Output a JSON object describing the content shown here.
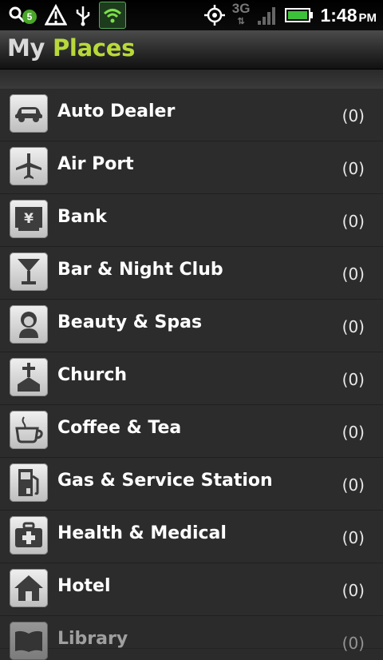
{
  "status_bar": {
    "notification_count": "5",
    "network": "3G",
    "time": "1:48",
    "ampm": "PM",
    "icons": [
      "search-notification-icon",
      "warning-icon",
      "usb-icon",
      "wifi-app-icon",
      "gps-icon",
      "signal-icon",
      "battery-icon"
    ]
  },
  "header": {
    "title_part1": "My",
    "title_part2": "Places",
    "accent_color": "#b8d93a"
  },
  "places": [
    {
      "label": "Auto Dealer",
      "count": "(0)",
      "icon": "car-icon"
    },
    {
      "label": "Air Port",
      "count": "(0)",
      "icon": "airplane-icon"
    },
    {
      "label": "Bank",
      "count": "(0)",
      "icon": "yen-icon"
    },
    {
      "label": "Bar & Night Club",
      "count": "(0)",
      "icon": "cocktail-icon"
    },
    {
      "label": "Beauty & Spas",
      "count": "(0)",
      "icon": "woman-icon"
    },
    {
      "label": "Church",
      "count": "(0)",
      "icon": "church-icon"
    },
    {
      "label": "Coffee & Tea",
      "count": "(0)",
      "icon": "coffee-cup-icon"
    },
    {
      "label": "Gas & Service Station",
      "count": "(0)",
      "icon": "gas-pump-icon"
    },
    {
      "label": "Health & Medical",
      "count": "(0)",
      "icon": "medical-kit-icon"
    },
    {
      "label": "Hotel",
      "count": "(0)",
      "icon": "house-icon"
    },
    {
      "label": "Library",
      "count": "(0)",
      "icon": "book-icon"
    }
  ]
}
